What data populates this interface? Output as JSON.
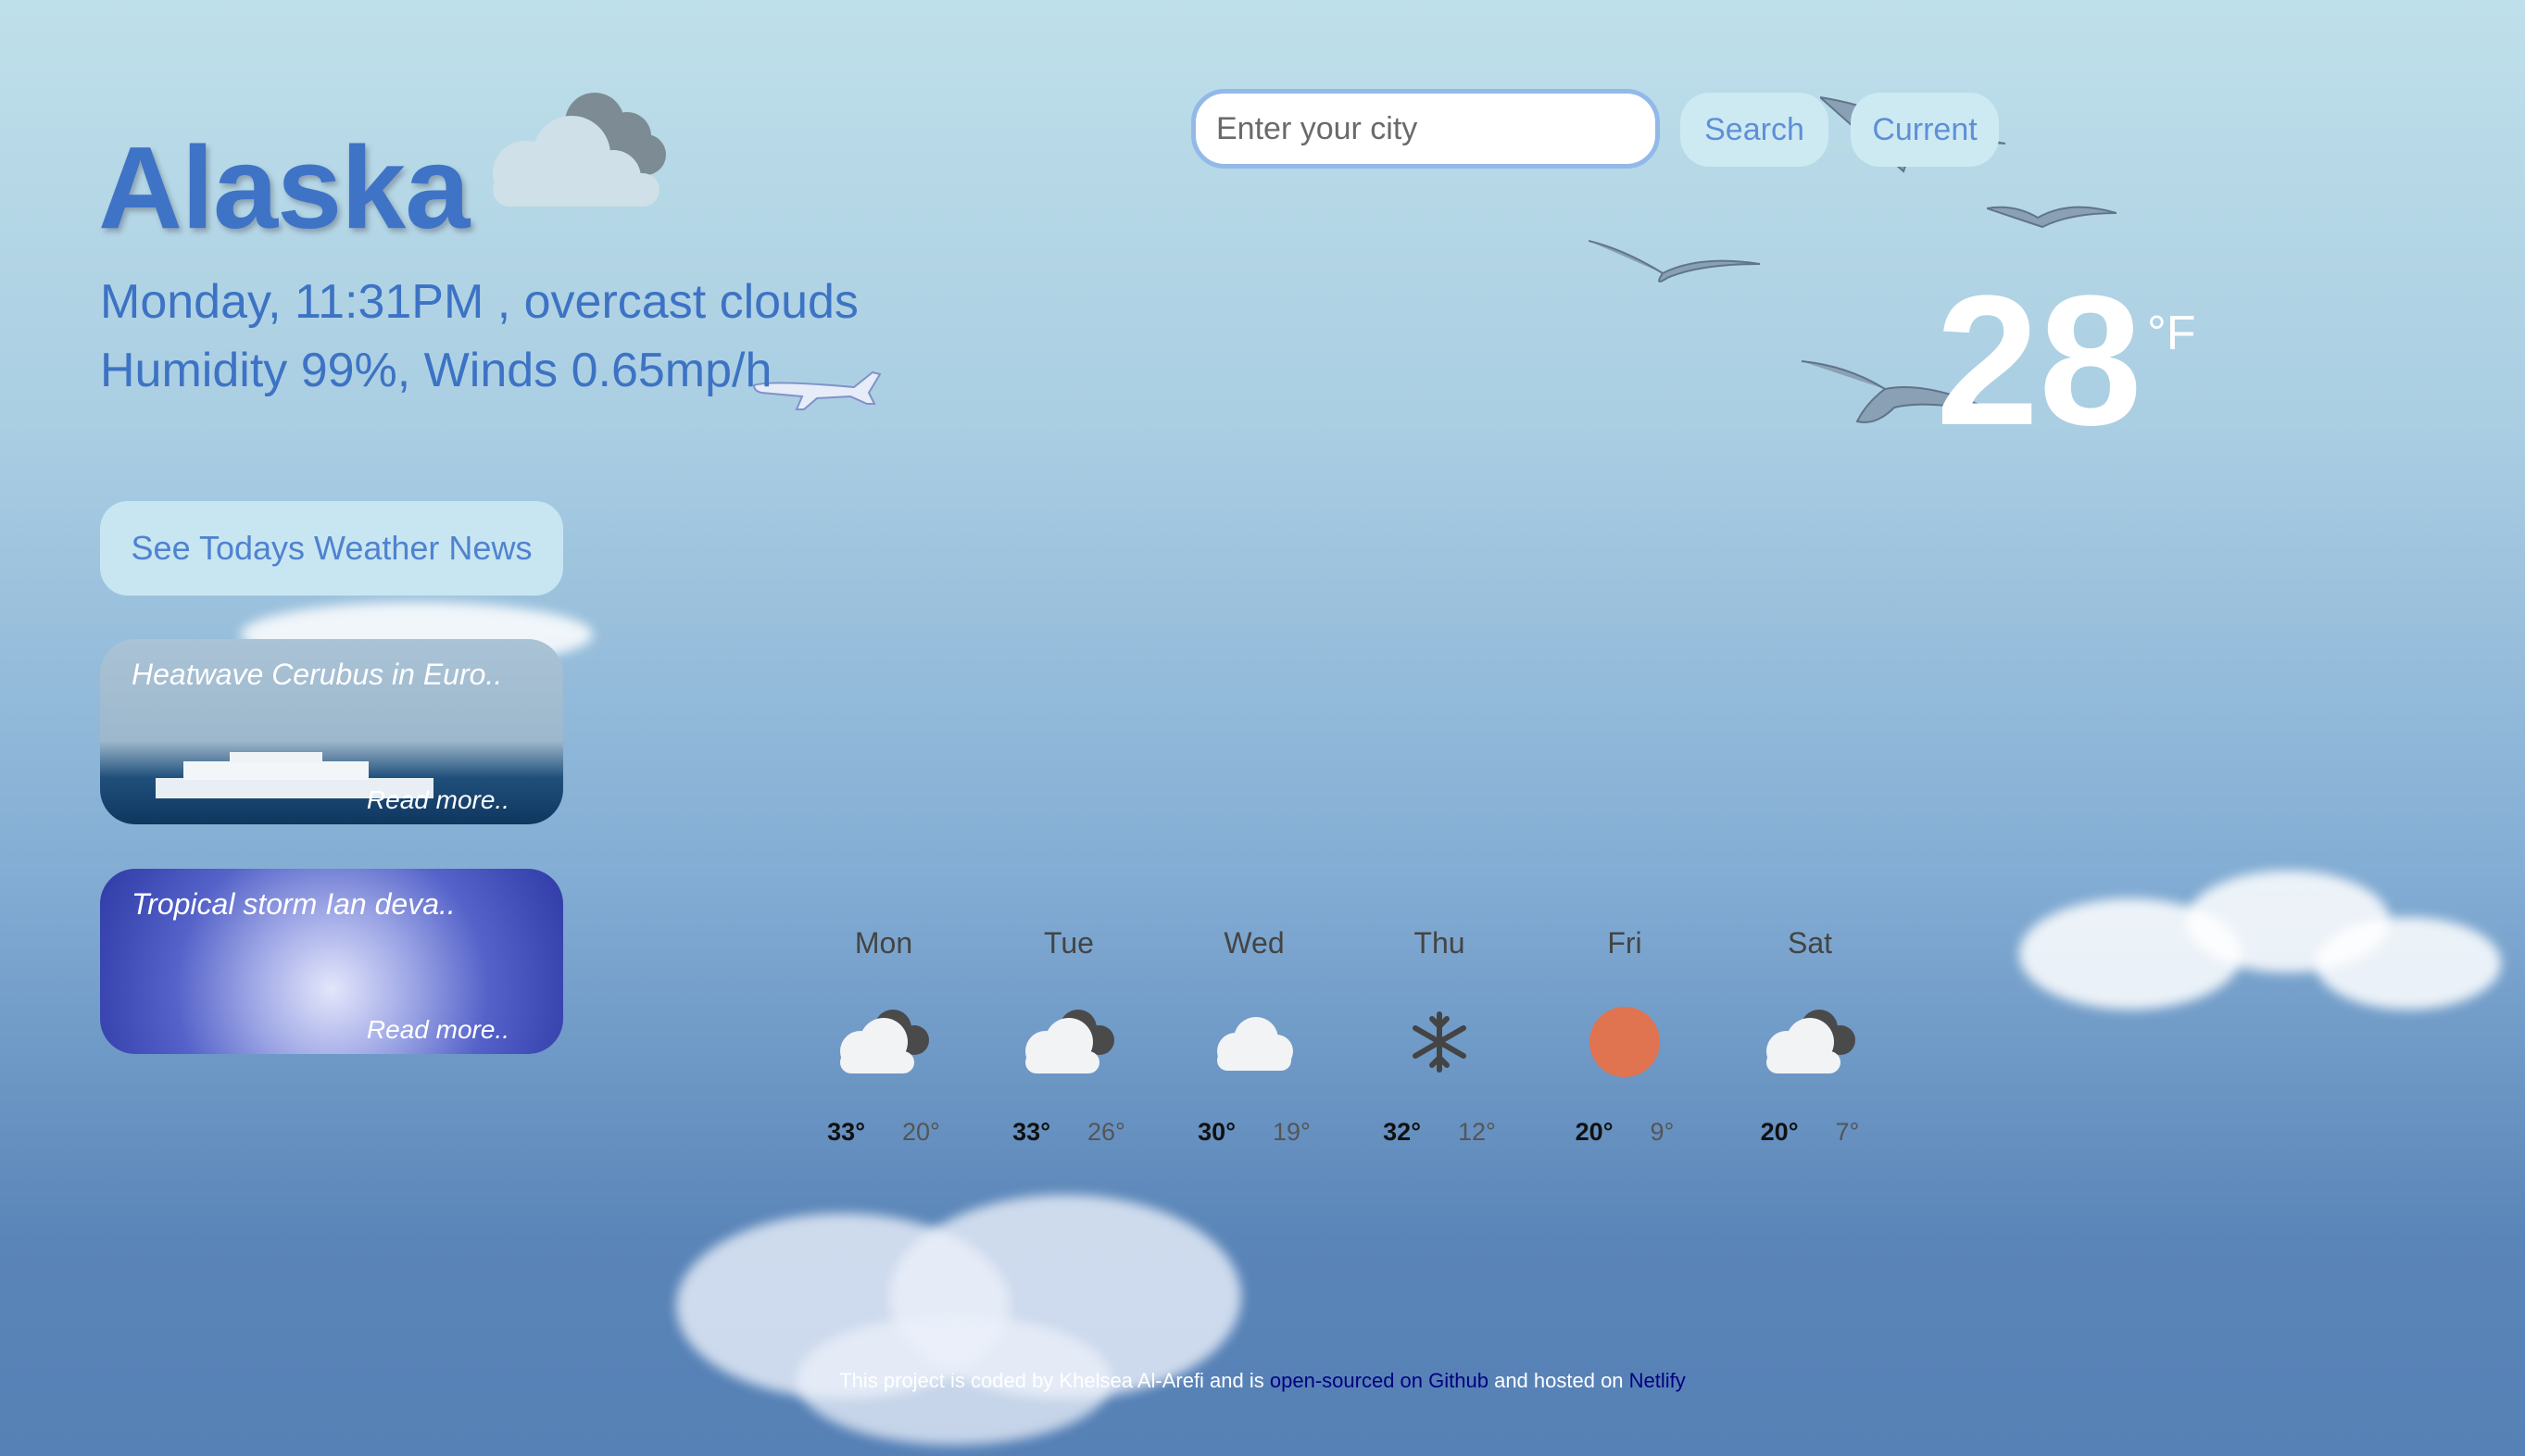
{
  "location": {
    "city": "Alaska",
    "datetime_description": "Monday, 11:31PM , overcast clouds",
    "humidity_winds": "Humidity 99%, Winds 0.65mp/h",
    "current_icon": "overcast-cloud-icon"
  },
  "search": {
    "placeholder": "Enter your city",
    "search_label": "Search",
    "current_label": "Current"
  },
  "current_temp": {
    "value": "28",
    "unit": "°F"
  },
  "news": {
    "button_label": "See Todays Weather News",
    "articles": [
      {
        "title": "Heatwave Cerubus in Euro..",
        "read_more": "Read more.."
      },
      {
        "title": "Tropical storm Ian deva..",
        "read_more": "Read more.."
      }
    ]
  },
  "forecast": [
    {
      "day": "Mon",
      "icon": "cloudy-icon",
      "max": "33°",
      "min": "20°"
    },
    {
      "day": "Tue",
      "icon": "cloudy-icon",
      "max": "33°",
      "min": "26°"
    },
    {
      "day": "Wed",
      "icon": "cloud-icon",
      "max": "30°",
      "min": "19°"
    },
    {
      "day": "Thu",
      "icon": "snowflake-icon",
      "max": "32°",
      "min": "12°"
    },
    {
      "day": "Fri",
      "icon": "sun-icon",
      "max": "20°",
      "min": "9°"
    },
    {
      "day": "Sat",
      "icon": "cloudy-icon",
      "max": "20°",
      "min": "7°"
    }
  ],
  "footer": {
    "text_1": "This project is coded by Khelsea Al-Arefi and is",
    "github_link": "open-sourced on Github",
    "text_2": "and hosted on",
    "netlify_link": "Netlify"
  },
  "colors": {
    "accent": "#3e73c6",
    "sun": "#e07350",
    "link": "#000080"
  }
}
